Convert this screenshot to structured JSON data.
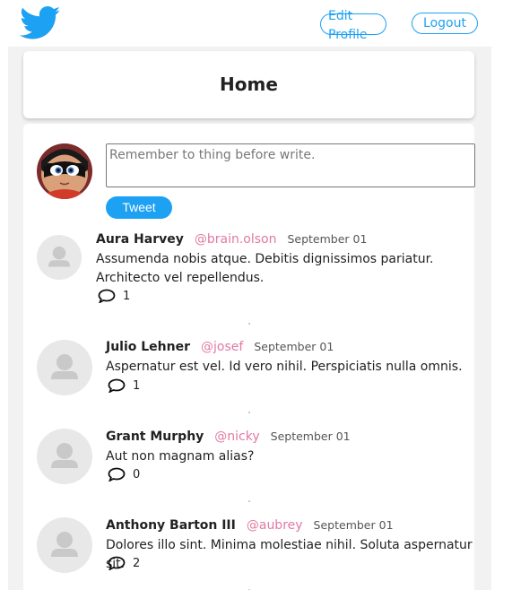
{
  "header": {
    "logo_icon": "twitter-bird-icon",
    "edit_profile_label": "Edit Profile",
    "logout_label": "Logout",
    "accent": "#1da1f2"
  },
  "home": {
    "title": "Home"
  },
  "composer": {
    "placeholder": "Remember to thing before write.",
    "tweet_label": "Tweet"
  },
  "tweets": [
    {
      "name": "Aura Harvey",
      "handle": "@brain.olson",
      "date": "September 01",
      "text": "Assumenda nobis atque. Debitis dignissimos pariatur. Architecto vel repellendus.",
      "comments": "1"
    },
    {
      "name": "Julio Lehner",
      "handle": "@josef",
      "date": "September 01",
      "text": "Aspernatur est vel. Id vero nihil. Perspiciatis nulla omnis.",
      "comments": "1"
    },
    {
      "name": "Grant Murphy",
      "handle": "@nicky",
      "date": "September 01",
      "text": "Aut non magnam alias?",
      "comments": "0"
    },
    {
      "name": "Anthony Barton III",
      "handle": "@aubrey",
      "date": "September 01",
      "text": "Dolores illo sint. Minima molestiae nihil. Soluta aspernatur sit.",
      "comments": "2"
    }
  ]
}
